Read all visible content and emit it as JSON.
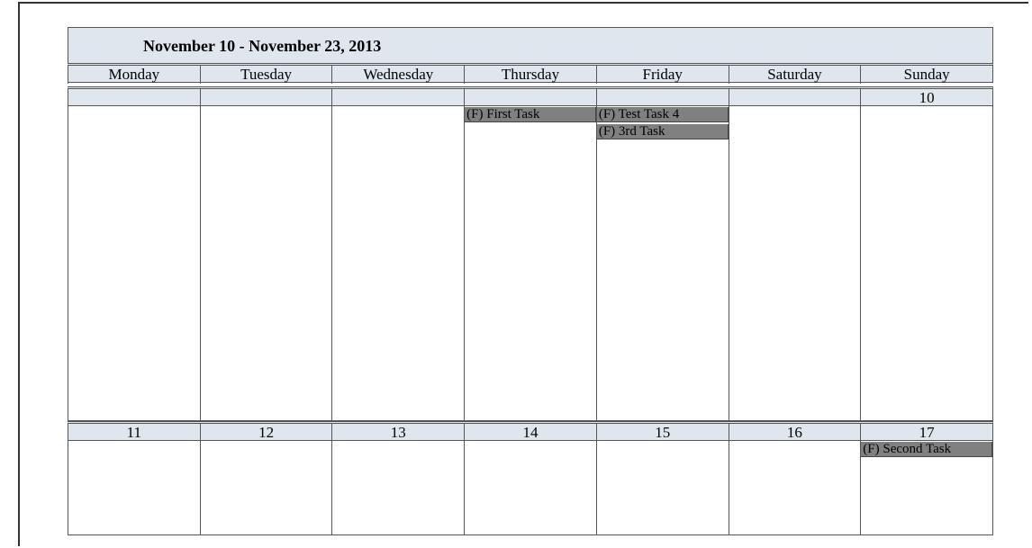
{
  "title": "November 10 - November 23, 2013",
  "days": [
    "Monday",
    "Tuesday",
    "Wednesday",
    "Thursday",
    "Friday",
    "Saturday",
    "Sunday"
  ],
  "week1": {
    "dates": [
      "",
      "",
      "",
      "",
      "",
      "",
      "10"
    ],
    "cells": [
      [],
      [],
      [],
      [
        "(F) First Task"
      ],
      [
        "(F) Test Task 4",
        "(F) 3rd Task"
      ],
      [],
      []
    ]
  },
  "week2": {
    "dates": [
      "11",
      "12",
      "13",
      "14",
      "15",
      "16",
      "17"
    ],
    "cells": [
      [],
      [],
      [],
      [],
      [],
      [],
      [
        "(F) Second Task"
      ]
    ]
  }
}
